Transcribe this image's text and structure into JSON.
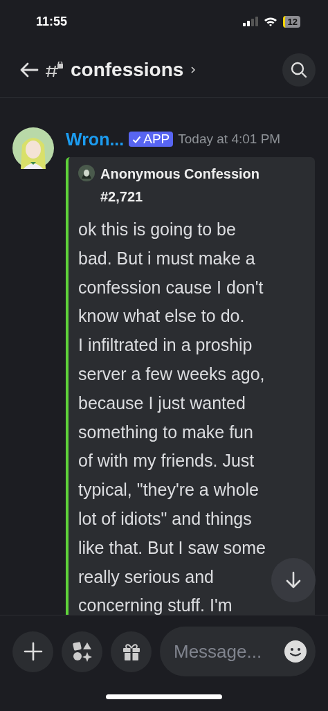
{
  "status_bar": {
    "time": "11:55",
    "battery": "12"
  },
  "header": {
    "channel": "confessions"
  },
  "message": {
    "author": "Wron...",
    "badge": "APP",
    "timestamp": "Today at 4:01 PM",
    "embed": {
      "title": "Anonymous Confession #2,721",
      "color": "#5fd33a",
      "lines": [
        "ok this is going to be",
        "bad. But i must make a",
        "confession cause I don't",
        "know what else to do.",
        "I infiltrated in a proship",
        "server a few weeks ago,",
        "because I just wanted",
        "something to make fun",
        "of with my friends. Just",
        "typical, \"they're a whole",
        "lot of idiots\" and things",
        "like that. But I saw some",
        "really serious and",
        "concerning stuff. I'm"
      ]
    }
  },
  "composer": {
    "placeholder": "Message..."
  }
}
